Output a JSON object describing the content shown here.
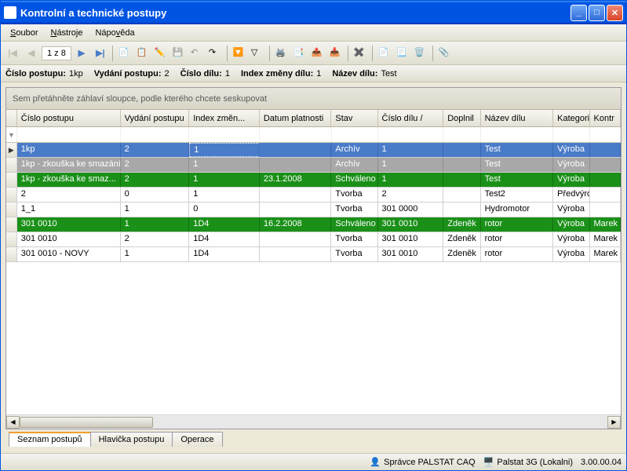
{
  "window": {
    "title": "Kontrolní a technické postupy"
  },
  "menu": {
    "soubor": "Soubor",
    "nastroje": "Nástroje",
    "napoveda": "Nápověda"
  },
  "pager": {
    "text": "1 z 8"
  },
  "infobar": {
    "l_cislo": "Číslo postupu:",
    "v_cislo": "1kp",
    "l_vydani": "Vydání postupu:",
    "v_vydani": "2",
    "l_cdilu": "Číslo dílu:",
    "v_cdilu": "1",
    "l_izmeny": "Index změny dílu:",
    "v_izmeny": "1",
    "l_nazev": "Název dílu:",
    "v_nazev": "Test"
  },
  "grouppanel": "Sem přetáhněte záhlaví sloupce, podle kterého chcete seskupovat",
  "columns": [
    "Číslo postupu",
    "Vydání postupu",
    "Index změn...",
    "Datum platnosti",
    "Stav",
    "Číslo dílu     /",
    "Doplnil",
    "Název dílu",
    "Kategorie",
    "Kontr"
  ],
  "rows": [
    {
      "style": "selected",
      "cells": [
        "1kp",
        "2",
        "1",
        "",
        "Archív",
        "1",
        "",
        "Test",
        "Výroba",
        ""
      ]
    },
    {
      "style": "gray",
      "cells": [
        "1kp - zkouška ke smazání",
        "2",
        "1",
        "",
        "Archív",
        "1",
        "",
        "Test",
        "Výroba",
        ""
      ]
    },
    {
      "style": "green",
      "cells": [
        "1kp - zkouška ke smaz...",
        "2",
        "1",
        "23.1.2008",
        "Schváleno",
        "1",
        "",
        "Test",
        "Výroba",
        ""
      ]
    },
    {
      "style": "white",
      "cells": [
        "2",
        "0",
        "1",
        "",
        "Tvorba",
        "2",
        "",
        "Test2",
        "Předvýroba",
        ""
      ]
    },
    {
      "style": "white",
      "cells": [
        "1_1",
        "1",
        "0",
        "",
        "Tvorba",
        "301 0000",
        "",
        "Hydromotor",
        "Výroba",
        ""
      ]
    },
    {
      "style": "green",
      "cells": [
        "301 0010",
        "1",
        "1D4",
        "16.2.2008",
        "Schváleno",
        "301 0010",
        "Zdeněk",
        "rotor",
        "Výroba",
        "Marek"
      ]
    },
    {
      "style": "white",
      "cells": [
        "301 0010",
        "2",
        "1D4",
        "",
        "Tvorba",
        "301 0010",
        "Zdeněk",
        "rotor",
        "Výroba",
        "Marek"
      ]
    },
    {
      "style": "white",
      "cells": [
        "301 0010 - NOVY",
        "1",
        "1D4",
        "",
        "Tvorba",
        "301 0010",
        "Zdeněk",
        "rotor",
        "Výroba",
        "Marek"
      ]
    }
  ],
  "tabs": {
    "t1": "Seznam postupů",
    "t2": "Hlavička postupu",
    "t3": "Operace"
  },
  "status": {
    "user": "Správce PALSTAT CAQ",
    "conn": "Palstat 3G (Lokalni)",
    "ver": "3.00.00.04"
  },
  "icons": {
    "first": "|◀",
    "prev": "◀",
    "next": "▶",
    "last": "▶|",
    "new": "✱",
    "dup": "📋",
    "edit": "✎",
    "save": "💾",
    "cancel": "↶",
    "redo": "↷",
    "filter": "▼",
    "filter2": "▽",
    "print": "🖨",
    "copy": "📑",
    "export": "⤴",
    "import": "⤵",
    "flag": "✖",
    "doc1": "📄",
    "doc2": "📃",
    "trash": "🗑",
    "attach": "📎"
  }
}
